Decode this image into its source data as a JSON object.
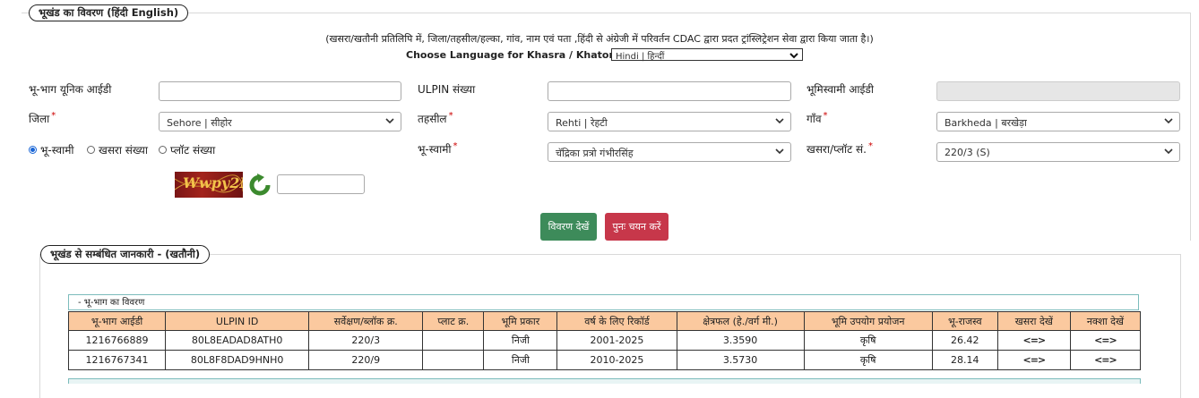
{
  "section1": {
    "legend_title": "भूखंड का विवरण  (हिंदी",
    "legend_lang": "English)",
    "note": "(खसरा/खतौनी प्रतिलिपि में, जिला/तहसील/हल्का, गांव, नाम एवं पता ,हिंदी से अंग्रेजी में परिवर्तन CDAC द्वारा प्रदत ट्रांस्लिट्रेशन सेवा द्वारा किया जाता है।)",
    "language_label": "Choose Language for Khasra / Khatoni Copy:",
    "language_value": "Hindi | हिन्दीं"
  },
  "form": {
    "unique_id_label": "भू-भाग यूनिक आईडी",
    "unique_id_value": "",
    "ulpin_label": "ULPIN संख्या",
    "ulpin_value": "",
    "owner_id_label": "भूमिस्वामी आईडी",
    "owner_id_value": "",
    "district_label": "जिला",
    "district_value": "Sehore | सीहोर",
    "tehsil_label": "तहसील",
    "tehsil_value": "Rehti | रेहटी",
    "village_label": "गाँव",
    "village_value": "Barkheda | बरखेड़ा",
    "radio_options": [
      "भू-स्वामी",
      "खसरा संख्या",
      "प्लॉट संख्या"
    ],
    "radio_selected": 0,
    "owner_label": "भू-स्वामी",
    "owner_value": "चॅद्रिका प्रत्रो गंभीरसिंह",
    "khasra_label": "खसरा/प्लॉट सं.",
    "khasra_value": "220/3 (S)",
    "required_mark": "*",
    "captcha_text": "Wwpy2N",
    "captcha_input": ""
  },
  "buttons": {
    "view": "विवरण देखें",
    "reset": "पुनः चयन करें"
  },
  "section2": {
    "legend_title": "भूखंड से सम्बंधित जानकारी -   (खतौनी)",
    "table_caption": "- भू-भाग का विवरण",
    "columns": [
      "भू-भाग आईडी",
      "ULPIN ID",
      "सर्वेक्षण/ब्लॉक क्र.",
      "प्लाट क्र.",
      "भूमि प्रकार",
      "वर्ष के लिए रिकॉर्ड",
      "क्षेत्रफल (हे./वर्ग मी.)",
      "भूमि उपयोग प्रयोजन",
      "भू-राजस्व",
      "खसरा देखें",
      "नक्शा देखें"
    ],
    "rows": [
      [
        "1216766889",
        "80L8EADAD8ATH0",
        "220/3",
        "",
        "निजी",
        "2001-2025",
        "3.3590",
        "कृषि",
        "26.42",
        "<=>",
        "<=>"
      ],
      [
        "1216767341",
        "80L8F8DAD9HNH0",
        "220/9",
        "",
        "निजी",
        "2010-2025",
        "3.5730",
        "कृषि",
        "28.14",
        "<=>",
        "<=>"
      ]
    ]
  },
  "icons": {
    "refresh": "refresh-icon",
    "dropdown": "chevron-down-icon"
  },
  "colors": {
    "view_button": "#3d8b5a",
    "reset_button": "#c7374a",
    "table_header": "#fbc99f",
    "captcha_bg": "#8b1a1a"
  }
}
